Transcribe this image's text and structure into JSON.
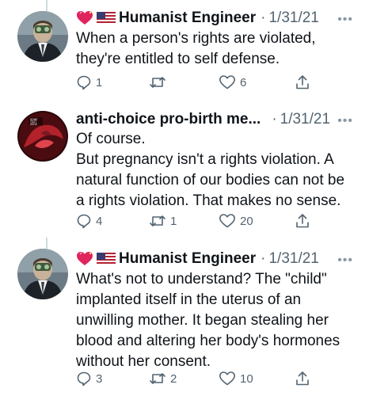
{
  "tweets": [
    {
      "display_name": "Humanist Engineer",
      "emoji_prefix": [
        "sparkling-heart",
        "us-flag"
      ],
      "separator": "·",
      "date": "1/31/21",
      "lines": [
        "When a person's rights are violated,",
        "they're entitled to self defense."
      ],
      "reply_count": "1",
      "retweet_count": "",
      "like_count": "6"
    },
    {
      "display_name": "anti-choice pro-birth me...",
      "emoji_prefix": [],
      "separator": "·",
      "date": "1/31/21",
      "lines": [
        "Of course.",
        "But pregnancy isn't a rights violation. A",
        "natural function of our bodies can not be",
        "a rights violation. That makes no sense."
      ],
      "reply_count": "4",
      "retweet_count": "1",
      "like_count": "20"
    },
    {
      "display_name": "Humanist Engineer",
      "emoji_prefix": [
        "sparkling-heart",
        "us-flag"
      ],
      "separator": "·",
      "date": "1/31/21",
      "lines": [
        "What's not to understand? The \"child\"",
        "implanted itself in the uterus of an",
        "unwilling mother. It began stealing her",
        "blood and altering her body's hormones",
        "without her consent."
      ],
      "reply_count": "3",
      "retweet_count": "2",
      "like_count": "10"
    }
  ],
  "colors": {
    "text": "#0f1419",
    "muted": "#536471",
    "line": "#cfd9de",
    "heart": "#e0245e"
  }
}
